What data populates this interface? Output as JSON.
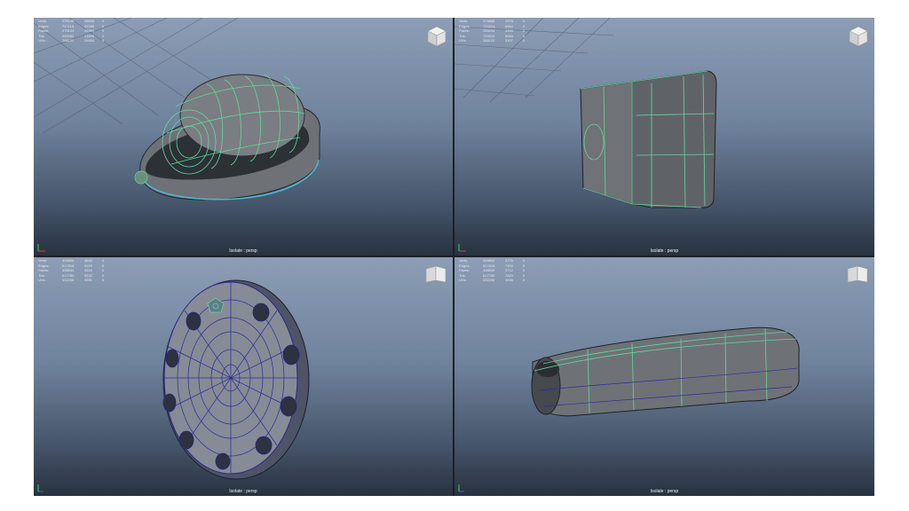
{
  "hud_labels": [
    "Verts:",
    "Edges:",
    "Faces:",
    "Tris:",
    "UVs:"
  ],
  "viewports": [
    {
      "camera_label": "Isolate : persp",
      "hud": [
        [
          "276136",
          "28558",
          "0"
        ],
        [
          "747116",
          "57286",
          "0"
        ],
        [
          "270124",
          "28364",
          "0"
        ],
        [
          "290262",
          "21598",
          "0"
        ],
        [
          "286122",
          "25554",
          "0"
        ]
      ]
    },
    {
      "camera_label": "Isolate : persp",
      "hud": [
        [
          "274866",
          "3376",
          "0"
        ],
        [
          "733214",
          "6664",
          "0"
        ],
        [
          "253234",
          "3300",
          "0"
        ],
        [
          "733512",
          "6664",
          "0"
        ],
        [
          "286122",
          "3307",
          "0"
        ]
      ]
    },
    {
      "camera_label": "Isolate : persp",
      "hud": [
        [
          "309806",
          "3540",
          "0"
        ],
        [
          "617818",
          "9229",
          "0"
        ],
        [
          "308540",
          "3520",
          "0"
        ],
        [
          "617780",
          "9232",
          "0"
        ],
        [
          "332206",
          "3591",
          "0"
        ]
      ]
    },
    {
      "camera_label": "Isolate : persp",
      "hud": [
        [
          "309806",
          "3776",
          "0"
        ],
        [
          "617818",
          "7454",
          "0"
        ],
        [
          "308540",
          "3712",
          "0"
        ],
        [
          "617780",
          "7424",
          "0"
        ],
        [
          "332206",
          "3946",
          "0"
        ]
      ]
    }
  ]
}
